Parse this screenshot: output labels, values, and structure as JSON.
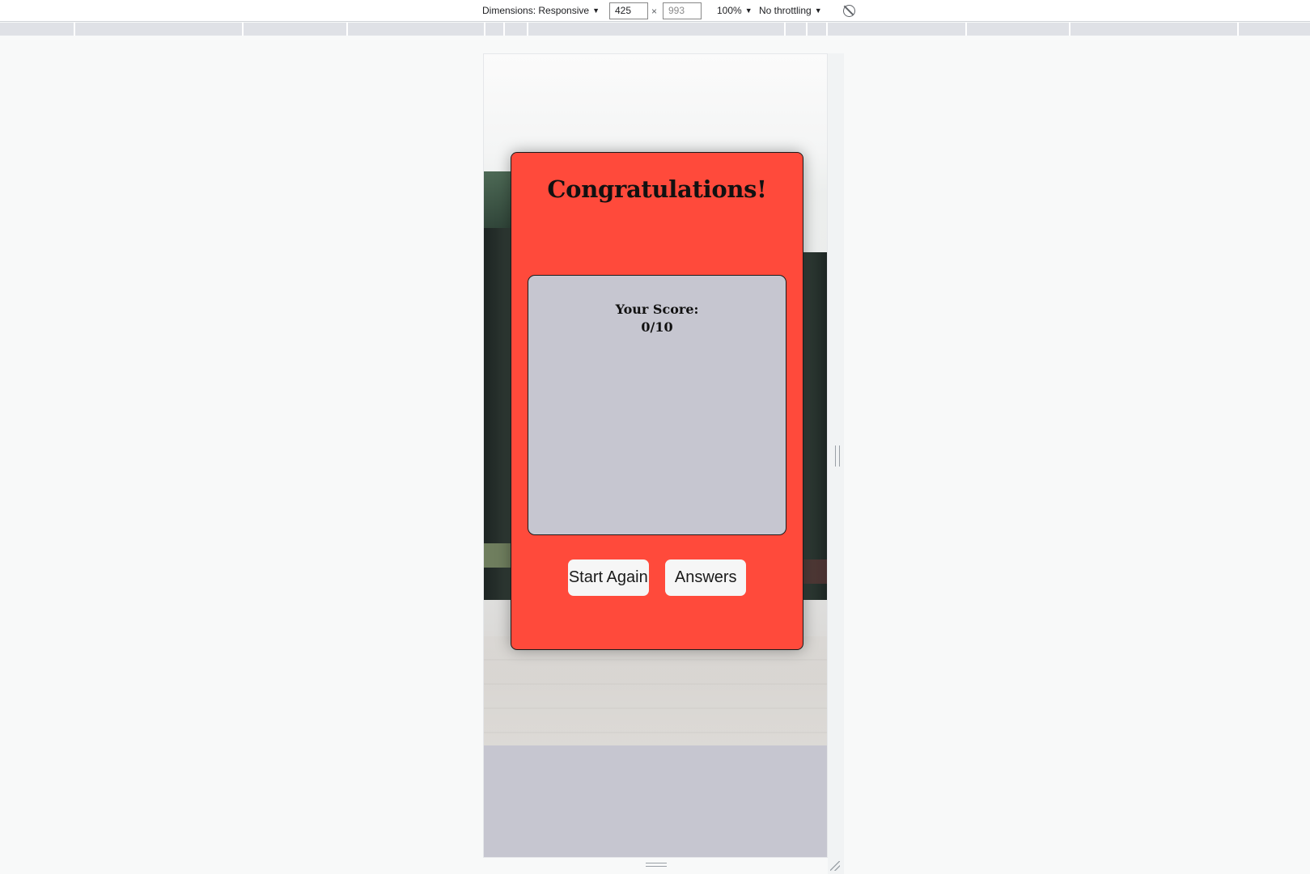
{
  "devtools": {
    "dimensions_label": "Dimensions: Responsive",
    "width_value": "425",
    "height_placeholder": "993",
    "times_glyph": "×",
    "zoom_label": "100%",
    "throttling_label": "No throttling",
    "caret": "▼",
    "rotate_icon": "rotate-icon"
  },
  "card": {
    "title": "Congratulations!",
    "score_label": "Your Score:",
    "score_value": "0/10",
    "start_again_label": "Start Again",
    "answers_label": "Answers",
    "background_color": "#ff4a3b",
    "panel_color": "#c6c6d0"
  }
}
